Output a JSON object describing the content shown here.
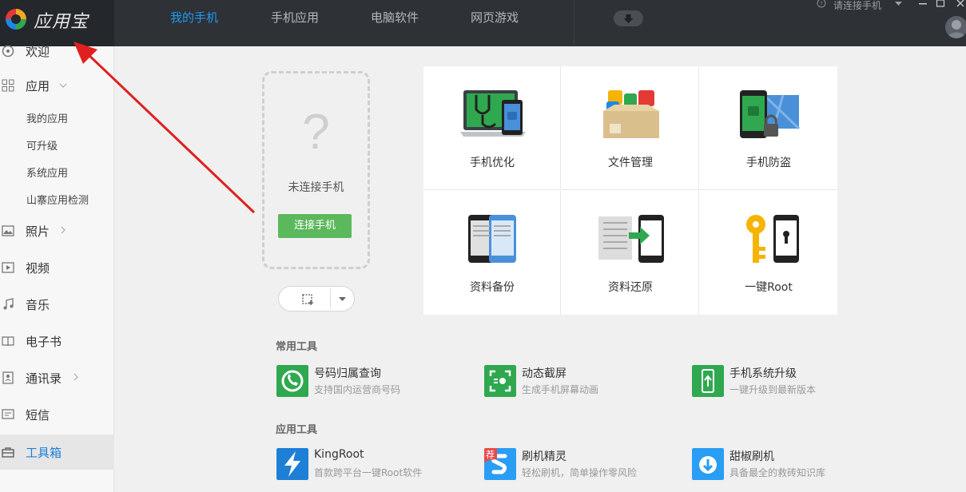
{
  "app": {
    "logo_text": "应用宝"
  },
  "colors": {
    "accent": "#1e9bf0",
    "green": "#5cb85c",
    "annotation_arrow": "#e02020"
  },
  "nav": {
    "tabs": [
      {
        "label": "我的手机",
        "active": true
      },
      {
        "label": "手机应用"
      },
      {
        "label": "电脑软件"
      },
      {
        "label": "网页游戏"
      }
    ]
  },
  "window": {
    "connect_text": "请连接手机"
  },
  "sidebar": {
    "items": [
      {
        "label": "欢迎",
        "icon": "welcome-icon"
      },
      {
        "label": "应用",
        "icon": "apps-grid-icon"
      },
      {
        "label": "照片",
        "icon": "photo-icon"
      },
      {
        "label": "视频",
        "icon": "video-icon"
      },
      {
        "label": "音乐",
        "icon": "music-icon"
      },
      {
        "label": "电子书",
        "icon": "ebook-icon"
      },
      {
        "label": "通讯录",
        "icon": "contacts-icon"
      },
      {
        "label": "短信",
        "icon": "sms-icon"
      },
      {
        "label": "工具箱",
        "icon": "toolbox-icon",
        "active": true
      }
    ],
    "app_sub": [
      "我的应用",
      "可升级",
      "系统应用",
      "山寨应用检测"
    ]
  },
  "phone": {
    "question": "?",
    "status": "未连接手机",
    "connect_btn": "连接手机"
  },
  "features": [
    {
      "label": "手机优化",
      "icon": "phone-optimize-icon"
    },
    {
      "label": "文件管理",
      "icon": "file-manage-icon"
    },
    {
      "label": "手机防盗",
      "icon": "anti-theft-icon"
    },
    {
      "label": "资料备份",
      "icon": "backup-icon"
    },
    {
      "label": "资料还原",
      "icon": "restore-icon"
    },
    {
      "label": "一键Root",
      "icon": "root-key-icon"
    }
  ],
  "sections": {
    "common": "常用工具",
    "app": "应用工具"
  },
  "common_tools": [
    {
      "name": "号码归属查询",
      "desc": "支持国内运营商号码",
      "icon": "phone-lookup-icon"
    },
    {
      "name": "动态截屏",
      "desc": "生成手机屏幕动画",
      "icon": "screen-capture-icon"
    },
    {
      "name": "手机系统升级",
      "desc": "一键升级到最新版本",
      "icon": "system-upgrade-icon"
    }
  ],
  "app_tools": [
    {
      "name": "KingRoot",
      "desc": "首款跨平台一键Root软件",
      "icon": "kingroot-icon"
    },
    {
      "name": "刷机精灵",
      "desc": "轻松刷机，简单操作零风险",
      "icon": "flash-wizard-icon",
      "badge": "荐"
    },
    {
      "name": "甜椒刷机",
      "desc": "具备最全的救砖知识库",
      "icon": "tianjiao-icon"
    }
  ]
}
